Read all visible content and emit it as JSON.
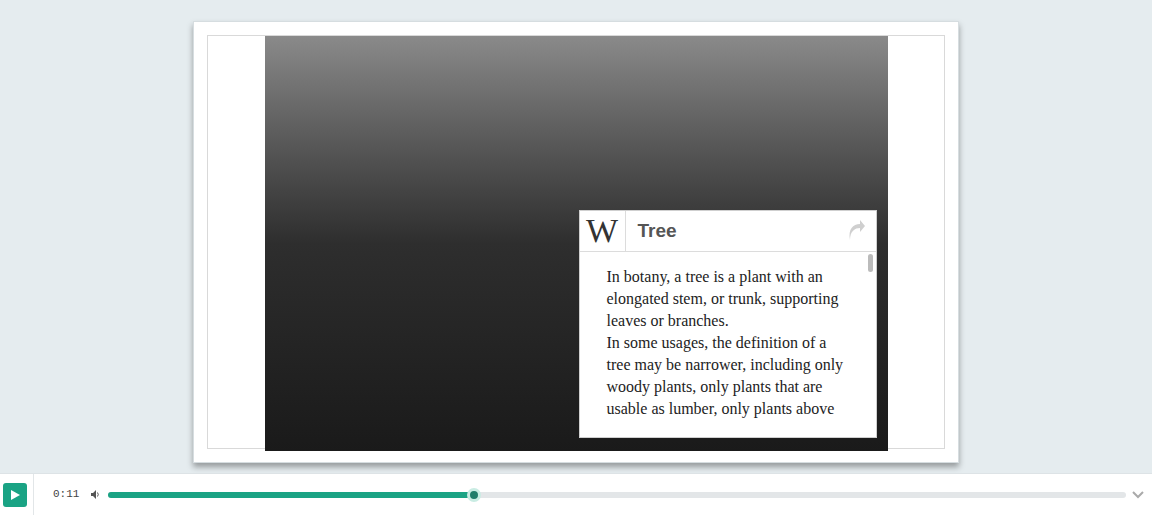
{
  "popup": {
    "logo": "W",
    "title": "Tree",
    "paragraphs": [
      "In botany, a tree is a plant with an elongated stem, or trunk, supporting leaves or branches.",
      "In some usages, the definition of a tree may be narrower, including only woody plants, only plants that are usable as lumber, only plants above"
    ]
  },
  "player": {
    "playing": false,
    "time": "0:11",
    "level": 0.36
  }
}
